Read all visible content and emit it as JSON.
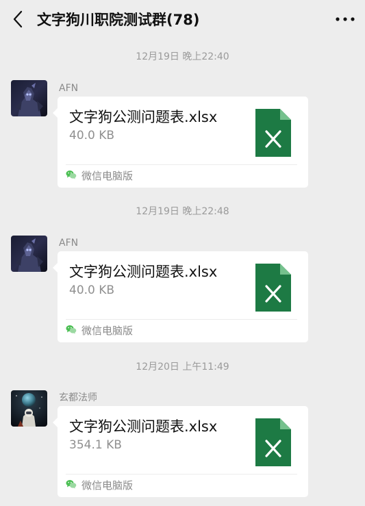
{
  "header": {
    "back_icon": "chevron-left-icon",
    "title": "文字狗川职院测试群(78)",
    "more_icon": "more-horizontal-icon"
  },
  "messages": [
    {
      "time": "12月19日 晚上22:40",
      "sender": "AFN",
      "avatar": "dark-armored-robot",
      "file_name": "文字狗公测问题表.xlsx",
      "file_size": "40.0 KB",
      "file_icon": "excel-file-icon",
      "source": "微信电脑版"
    },
    {
      "time": "12月19日 晚上22:48",
      "sender": "AFN",
      "avatar": "dark-armored-robot",
      "file_name": "文字狗公测问题表.xlsx",
      "file_size": "40.0 KB",
      "file_icon": "excel-file-icon",
      "source": "微信电脑版"
    },
    {
      "time": "12月20日 上午11:49",
      "sender": "玄都法师",
      "avatar": "astronaut-with-planet",
      "file_name": "文字狗公测问题表.xlsx",
      "file_size": "354.1 KB",
      "file_icon": "excel-file-icon",
      "source": "微信电脑版"
    }
  ],
  "colors": {
    "background": "#ededed",
    "card": "#ffffff",
    "excel_green": "#1d7a44",
    "excel_fold": "#75c18d",
    "wechat_green": "#4cbf54",
    "muted_text": "#8a8a8a"
  }
}
